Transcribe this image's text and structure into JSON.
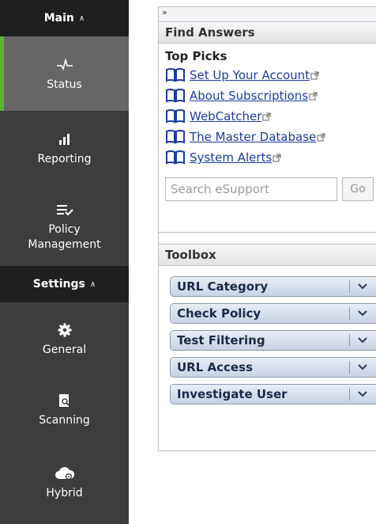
{
  "nav": {
    "main_header": "Main",
    "items_main": [
      {
        "label": "Status",
        "icon": "pulse-icon"
      },
      {
        "label": "Reporting",
        "icon": "bar-chart-icon"
      },
      {
        "label": "Policy Management",
        "icon": "checklist-icon"
      }
    ],
    "settings_header": "Settings",
    "items_settings": [
      {
        "label": "General",
        "icon": "gear-icon"
      },
      {
        "label": "Scanning",
        "icon": "scan-document-icon"
      },
      {
        "label": "Hybrid",
        "icon": "cloud-gear-icon"
      }
    ],
    "active": "Status",
    "accent": "#5cb531"
  },
  "panel": {
    "collapse_glyph": "»",
    "find_answers": {
      "title": "Find Answers",
      "top_picks_label": "Top Picks",
      "links": [
        "Set Up Your Account",
        "About Subscriptions",
        "WebCatcher",
        "The Master Database",
        "System Alerts"
      ],
      "search_placeholder": "Search eSupport",
      "go_label": "Go"
    },
    "toolbox": {
      "title": "Toolbox",
      "tools": [
        "URL Category",
        "Check Policy",
        "Test Filtering",
        "URL Access",
        "Investigate User"
      ]
    }
  }
}
